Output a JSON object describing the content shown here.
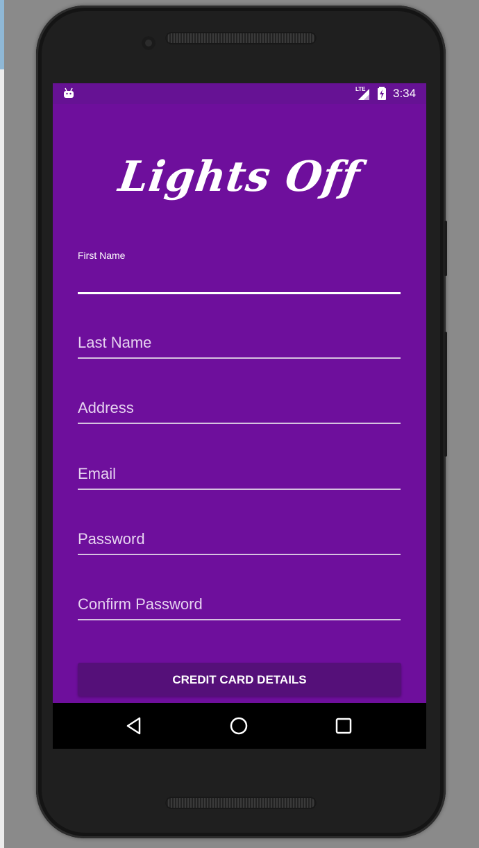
{
  "status_bar": {
    "network": "LTE",
    "time": "3:34"
  },
  "app": {
    "logo_text": "Lights Off"
  },
  "form": {
    "first_name": {
      "label": "First Name",
      "value": ""
    },
    "last_name": {
      "label": "Last Name",
      "value": ""
    },
    "address": {
      "label": "Address",
      "value": ""
    },
    "email": {
      "label": "Email",
      "value": ""
    },
    "password": {
      "label": "Password",
      "value": ""
    },
    "confirm_password": {
      "label": "Confirm Password",
      "value": ""
    },
    "submit_label": "CREDIT CARD DETAILS"
  },
  "nav_bar": {
    "icons": [
      "back-icon",
      "home-icon",
      "recents-icon"
    ]
  },
  "colors": {
    "app_background": "#6e0f9c",
    "status_bar": "#661294",
    "button": "#551079",
    "text": "#ffffff"
  }
}
